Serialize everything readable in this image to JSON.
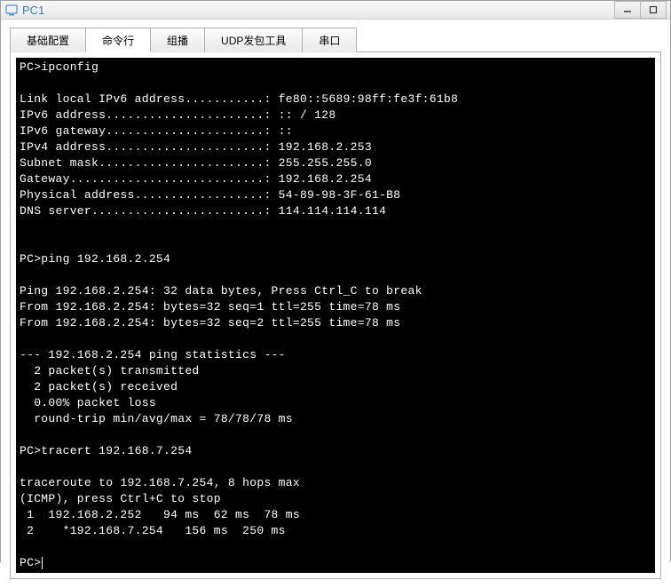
{
  "window": {
    "title": "PC1"
  },
  "tabs": {
    "items": [
      {
        "label": "基础配置"
      },
      {
        "label": "命令行"
      },
      {
        "label": "组播"
      },
      {
        "label": "UDP发包工具"
      },
      {
        "label": "串口"
      }
    ],
    "active_index": 1
  },
  "terminal": {
    "prompt": "PC>",
    "lines": [
      "PC>ipconfig",
      "",
      "Link local IPv6 address...........: fe80::5689:98ff:fe3f:61b8",
      "IPv6 address......................: :: / 128",
      "IPv6 gateway......................: ::",
      "IPv4 address......................: 192.168.2.253",
      "Subnet mask.......................: 255.255.255.0",
      "Gateway...........................: 192.168.2.254",
      "Physical address..................: 54-89-98-3F-61-B8",
      "DNS server........................: 114.114.114.114",
      "",
      "",
      "PC>ping 192.168.2.254",
      "",
      "Ping 192.168.2.254: 32 data bytes, Press Ctrl_C to break",
      "From 192.168.2.254: bytes=32 seq=1 ttl=255 time=78 ms",
      "From 192.168.2.254: bytes=32 seq=2 ttl=255 time=78 ms",
      "",
      "--- 192.168.2.254 ping statistics ---",
      "  2 packet(s) transmitted",
      "  2 packet(s) received",
      "  0.00% packet loss",
      "  round-trip min/avg/max = 78/78/78 ms",
      "",
      "PC>tracert 192.168.7.254",
      "",
      "traceroute to 192.168.7.254, 8 hops max",
      "(ICMP), press Ctrl+C to stop",
      " 1  192.168.2.252   94 ms  62 ms  78 ms",
      " 2    *192.168.7.254   156 ms  250 ms",
      ""
    ]
  }
}
